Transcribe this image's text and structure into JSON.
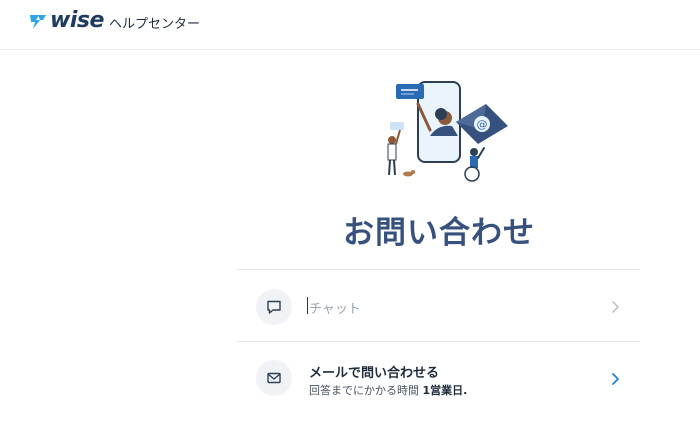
{
  "header": {
    "logo_text": "wise",
    "help_center_label": "ヘルプセンター"
  },
  "main": {
    "title": "お問い合わせ",
    "options": [
      {
        "title": "チャット",
        "icon": "chat-bubble-icon",
        "state": "disabled"
      },
      {
        "title": "メールで問い合わせる",
        "subtitle_prefix": "回答までにかかる時間",
        "subtitle_value": "1営業日.",
        "icon": "mail-icon",
        "state": "enabled"
      }
    ]
  },
  "colors": {
    "brand_logo": "#1e3a5f",
    "title": "#37517e",
    "accent_blue": "#2b7fd4",
    "chevron_disabled": "#b5bcc4",
    "chevron_enabled": "#2b7fd4"
  }
}
